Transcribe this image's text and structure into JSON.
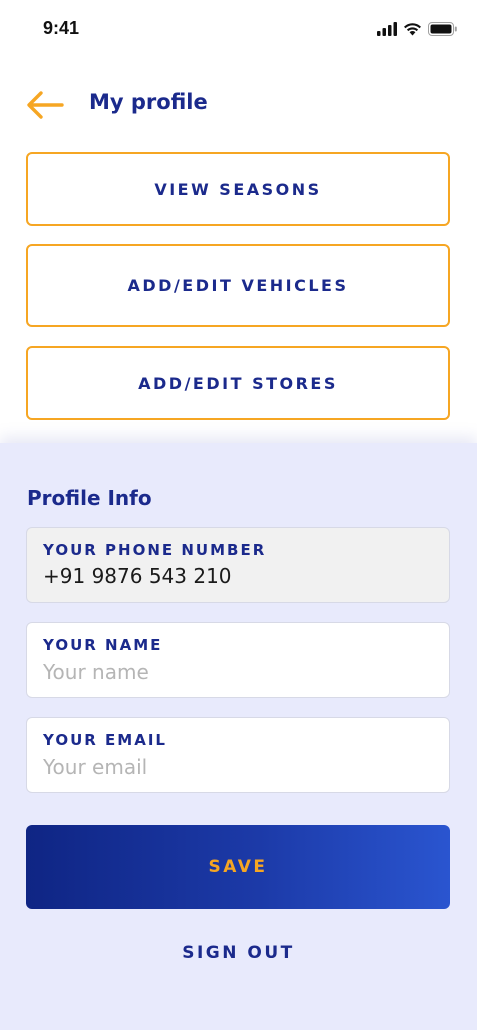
{
  "status_bar": {
    "time": "9:41",
    "icons": [
      "cellular-signal-icon",
      "wifi-icon",
      "battery-icon"
    ]
  },
  "header": {
    "back_icon": "arrow-left-icon",
    "title": "My profile"
  },
  "actions": {
    "view_seasons": "VIEW SEASONS",
    "add_edit_vehicles": "ADD/EDIT VEHICLES",
    "add_edit_stores": "ADD/EDIT STORES"
  },
  "profile": {
    "section_title": "Profile Info",
    "phone": {
      "label": "YOUR PHONE NUMBER",
      "value": "+91 9876 543 210"
    },
    "name": {
      "label": "YOUR NAME",
      "value": "",
      "placeholder": "Your name"
    },
    "email": {
      "label": "YOUR EMAIL",
      "value": "",
      "placeholder": "Your email"
    }
  },
  "footer": {
    "save_label": "SAVE",
    "signout_label": "SIGN OUT"
  },
  "colors": {
    "accent": "#f6a623",
    "brand": "#1b2a8c",
    "panel": "#e8eafc"
  }
}
